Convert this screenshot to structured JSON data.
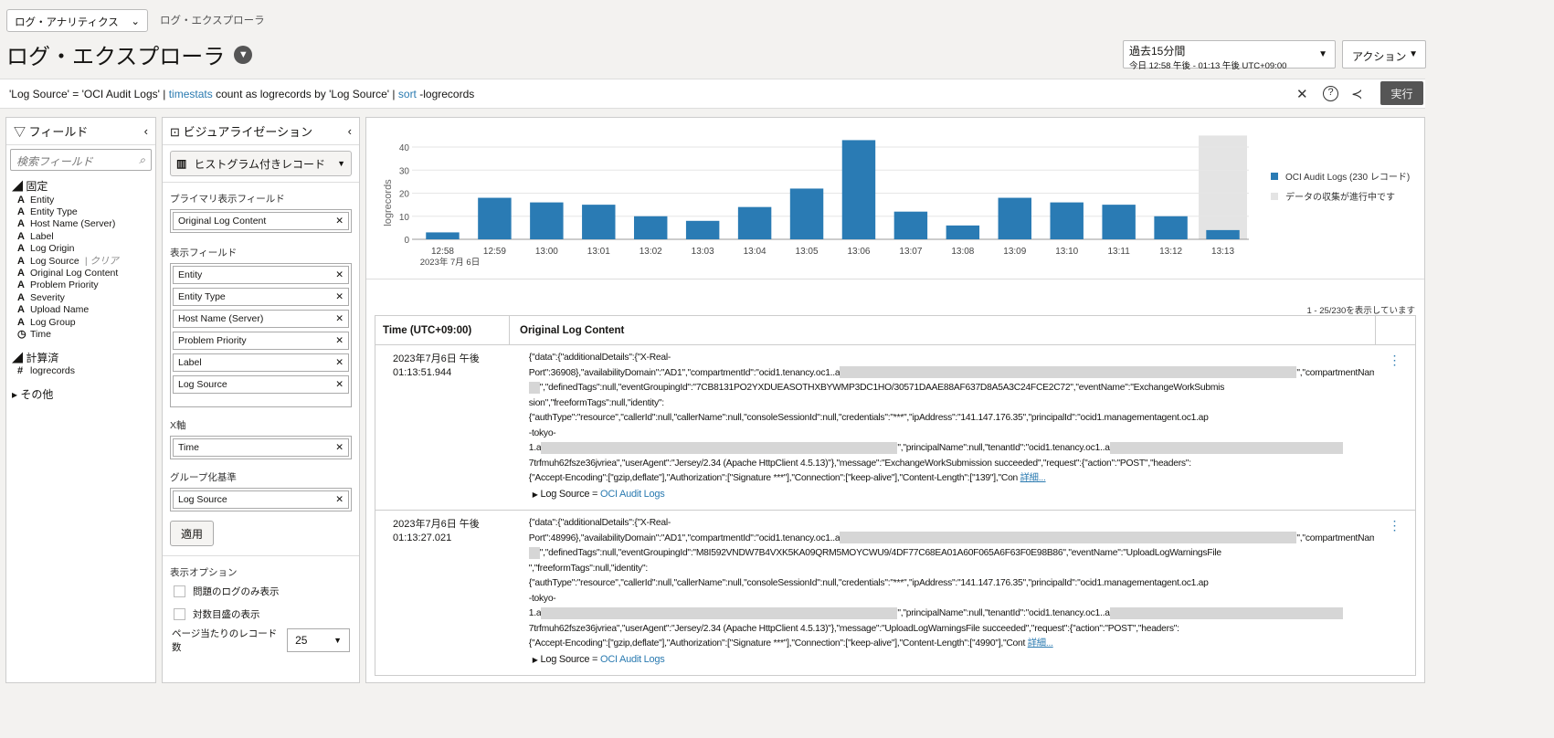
{
  "header": {
    "app_select": "ログ・アナリティクス",
    "breadcrumb": "ログ・エクスプローラ",
    "title": "ログ・エクスプローラ",
    "time_range": "過去15分間",
    "time_detail": "今日 12:58 午後 - 01:13 午後 UTC+09:00",
    "actions": "アクション"
  },
  "query": {
    "p1": "'Log Source' = 'OCI Audit Logs' | ",
    "k1": "timestats",
    "p2": " count as logrecords by 'Log Source' | ",
    "k2": "sort",
    "p3": " -logrecords",
    "run": "実行"
  },
  "fields": {
    "title": "フィールド",
    "search_placeholder": "検索フィールド",
    "pinned": "固定",
    "items": [
      {
        "t": "A",
        "n": "Entity"
      },
      {
        "t": "A",
        "n": "Entity Type"
      },
      {
        "t": "A",
        "n": "Host Name (Server)"
      },
      {
        "t": "A",
        "n": "Label"
      },
      {
        "t": "A",
        "n": "Log Origin"
      },
      {
        "t": "A",
        "n": "Log Source"
      },
      {
        "t": "A",
        "n": "Original Log Content"
      },
      {
        "t": "A",
        "n": "Problem Priority"
      },
      {
        "t": "A",
        "n": "Severity"
      },
      {
        "t": "A",
        "n": "Upload Name"
      },
      {
        "t": "A",
        "n": "Log Group"
      },
      {
        "t": "◷",
        "n": "Time"
      }
    ],
    "clear": "| クリア",
    "computed": "計算済",
    "computed_items": [
      {
        "t": "#",
        "n": "logrecords"
      }
    ],
    "other": "その他"
  },
  "viz": {
    "title": "ビジュアライゼーション",
    "type": "ヒストグラム付きレコード",
    "primary_label": "プライマリ表示フィールド",
    "primary": "Original Log Content",
    "display_label": "表示フィールド",
    "display": [
      "Entity",
      "Entity Type",
      "Host Name (Server)",
      "Problem Priority",
      "Label",
      "Log Source"
    ],
    "x_label": "X軸",
    "x": "Time",
    "group_label": "グループ化基準",
    "group": "Log Source",
    "apply": "適用",
    "options_label": "表示オプション",
    "opt1": "問題のログのみ表示",
    "opt2": "対数目盛の表示",
    "per_page_label": "ページ当たりのレコード数",
    "per_page": "25"
  },
  "chart_data": {
    "type": "bar",
    "ylabel": "logrecords",
    "categories": [
      "12:58",
      "12:59",
      "13:00",
      "13:01",
      "13:02",
      "13:03",
      "13:04",
      "13:05",
      "13:06",
      "13:07",
      "13:08",
      "13:09",
      "13:10",
      "13:11",
      "13:12",
      "13:13"
    ],
    "date_label": "2023年 7月 6日",
    "values": [
      3,
      18,
      16,
      15,
      10,
      8,
      14,
      22,
      43,
      12,
      6,
      18,
      16,
      15,
      10,
      4
    ],
    "ylim": [
      0,
      45
    ],
    "yticks": [
      0,
      10,
      20,
      30,
      40
    ],
    "in_progress_index": 15,
    "legend": [
      {
        "name": "OCI Audit Logs (230 レコード)",
        "color": "#2a7bb4"
      },
      {
        "name": "データの収集が進行中です",
        "color": "#e4e4e4"
      }
    ]
  },
  "table": {
    "count": "1 - 25/230を表示しています",
    "col_time": "Time (UTC+09:00)",
    "col_content": "Original Log Content",
    "more": "詳細...",
    "source_label": "Log Source = ",
    "rows": [
      {
        "date": "2023年7月6日 午後",
        "time": "01:13:51.944",
        "source": "OCI Audit Logs",
        "lines": [
          [
            "{\"data\":{\"additionalDetails\":{\"X-Real-"
          ],
          [
            "Port\":36908},\"availabilityDomain\":\"AD1\",\"compartmentId\":\"ocid1.tenancy.oc1..a",
            null,
            "\",\"compartmentName\":\"",
            null
          ],
          [
            null,
            "\",\"definedTags\":null,\"eventGroupingId\":\"7CB8131PO2YXDUEASOTHXBYWMP3DC1HO/30571DAAE88AF637D8A5A3C24FCE2C72\",\"eventName\":\"ExchangeWorkSubmis"
          ],
          [
            "sion\",\"freeformTags\":null,\"identity\":"
          ],
          [
            "{\"authType\":\"resource\",\"callerId\":null,\"callerName\":null,\"consoleSessionId\":null,\"credentials\":\"***\",\"ipAddress\":\"141.147.176.35\",\"principalId\":\"ocid1.managementagent.oc1.ap"
          ],
          [
            "-tokyo-"
          ],
          [
            "1.a",
            null,
            "\",\"principalName\":null,\"tenantId\":\"ocid1.tenancy.oc1..a",
            null
          ],
          [
            "7trfmuh62fsze36jvriea\",\"userAgent\":\"Jersey/2.34 (Apache HttpClient 4.5.13)\"},\"message\":\"ExchangeWorkSubmission succeeded\",\"request\":{\"action\":\"POST\",\"headers\":"
          ],
          [
            "{\"Accept-Encoding\":[\"gzip,deflate\"],\"Authorization\":[\"Signature ***\"],\"Connection\":[\"keep-alive\"],\"Content-Length\":[\"139\"],\"Con "
          ]
        ]
      },
      {
        "date": "2023年7月6日 午後",
        "time": "01:13:27.021",
        "source": "OCI Audit Logs",
        "lines": [
          [
            "{\"data\":{\"additionalDetails\":{\"X-Real-"
          ],
          [
            "Port\":48996},\"availabilityDomain\":\"AD1\",\"compartmentId\":\"ocid1.tenancy.oc1..a",
            null,
            "\",\"compartmentName\":\"",
            null
          ],
          [
            null,
            "\",\"definedTags\":null,\"eventGroupingId\":\"M8I592VNDW7B4VXK5KA09QRM5MOYCWU9/4DF77C68EA01A60F065A6F63F0E98B86\",\"eventName\":\"UploadLogWarningsFile"
          ],
          [
            "\",\"freeformTags\":null,\"identity\":"
          ],
          [
            "{\"authType\":\"resource\",\"callerId\":null,\"callerName\":null,\"consoleSessionId\":null,\"credentials\":\"***\",\"ipAddress\":\"141.147.176.35\",\"principalId\":\"ocid1.managementagent.oc1.ap"
          ],
          [
            "-tokyo-"
          ],
          [
            "1.a",
            null,
            "\",\"principalName\":null,\"tenantId\":\"ocid1.tenancy.oc1..a",
            null
          ],
          [
            "7trfmuh62fsze36jvriea\",\"userAgent\":\"Jersey/2.34 (Apache HttpClient 4.5.13)\"},\"message\":\"UploadLogWarningsFile succeeded\",\"request\":{\"action\":\"POST\",\"headers\":"
          ],
          [
            "{\"Accept-Encoding\":[\"gzip,deflate\"],\"Authorization\":[\"Signature ***\"],\"Connection\":[\"keep-alive\"],\"Content-Length\":[\"4990\"],\"Cont "
          ]
        ]
      }
    ]
  }
}
